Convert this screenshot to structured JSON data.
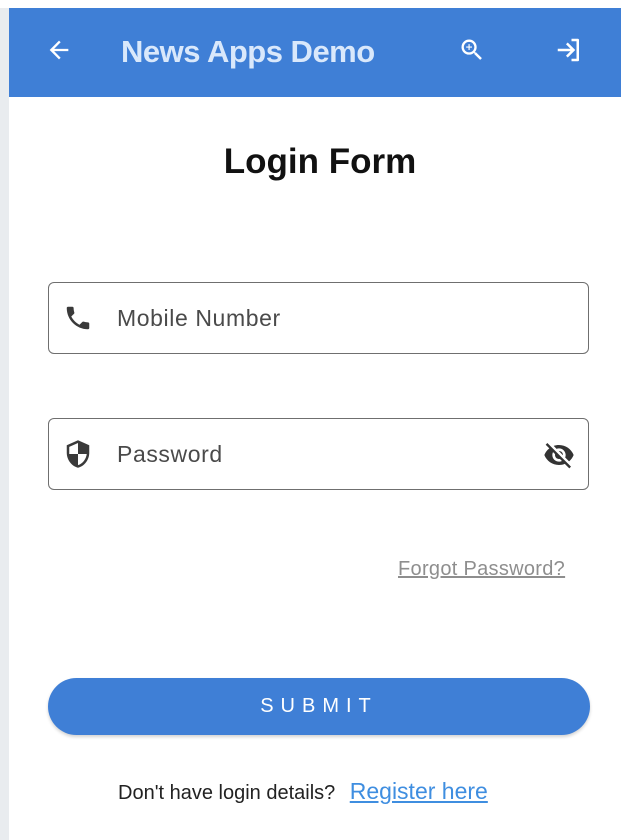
{
  "appbar": {
    "title": "News Apps Demo",
    "back_icon": "arrow-left-icon",
    "zoom_icon": "zoom-in-icon",
    "login_icon": "login-icon",
    "color": "#3f7fd6",
    "title_color": "#d9e8fb"
  },
  "form": {
    "title": "Login Form",
    "mobile": {
      "placeholder": "Mobile Number",
      "value": "",
      "icon": "phone-icon"
    },
    "password": {
      "placeholder": "Password",
      "value": "",
      "icon": "shield-icon",
      "toggle_icon": "eye-off-icon"
    },
    "forgot_label": "Forgot Password?",
    "submit_label": "SUBMIT",
    "register_prompt": "Don't have login details?",
    "register_link": "Register here"
  },
  "colors": {
    "primary": "#3f7fd6",
    "link": "#3f8ee0",
    "muted_link": "#8e8e8e"
  }
}
